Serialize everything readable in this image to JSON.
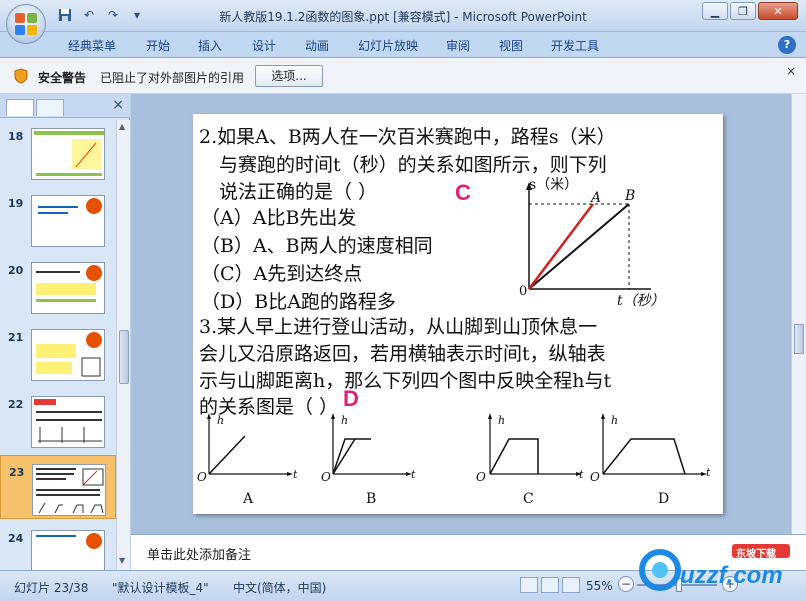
{
  "titlebar": {
    "title": "新人教版19.1.2函数的图象.ppt [兼容模式] - Microsoft PowerPoint",
    "minimize": "▁",
    "restore": "❐",
    "close": "✕"
  },
  "qat": {
    "save_icon": "save-icon",
    "undo_icon": "undo-icon",
    "redo_icon": "redo-icon",
    "customize": "▾"
  },
  "ribbon": {
    "tabs": [
      "经典菜单",
      "开始",
      "插入",
      "设计",
      "动画",
      "幻灯片放映",
      "审阅",
      "视图",
      "开发工具"
    ],
    "help": "?"
  },
  "security": {
    "title": "安全警告",
    "message": "已阻止了对外部图片的引用",
    "options_button": "选项...",
    "close": "×"
  },
  "slides_pane": {
    "close": "×",
    "slides": [
      {
        "number": "18"
      },
      {
        "number": "19"
      },
      {
        "number": "20"
      },
      {
        "number": "21"
      },
      {
        "number": "22"
      },
      {
        "number": "23"
      },
      {
        "number": "24"
      }
    ],
    "selected": "23"
  },
  "slide": {
    "q2_line1": "2.如果A、B两人在一次百米赛跑中，路程s（米）",
    "q2_line2": "与赛跑的时间t（秒）的关系如图所示，则下列",
    "q2_line3": "说法正确的是（    ）",
    "q2_answer": "C",
    "q2_optA": "（A）A比B先出发",
    "q2_optB": "（B）A、B两人的速度相同",
    "q2_optC": "（C）A先到达终点",
    "q2_optD": "（D）B比A跑的路程多",
    "q3_line1": "3.某人早上进行登山活动，从山脚到山顶休息一",
    "q3_line2": "会儿又沿原路返回，若用横轴表示时间t，纵轴表",
    "q3_line3": "示与山脚距离h，那么下列四个图中反映全程h与t",
    "q3_line4": "的关系图是（      ）",
    "q3_answer": "D",
    "graph1": {
      "y_label": "s（米）",
      "x_label": "t（秒）",
      "origin": "0",
      "line_a": "A",
      "line_b": "B"
    },
    "graphs": [
      {
        "label": "A",
        "h": "h",
        "t": "t",
        "origin": "O"
      },
      {
        "label": "B",
        "h": "h",
        "t": "t",
        "origin": "O"
      },
      {
        "label": "C",
        "h": "h",
        "t": "t",
        "origin": "O"
      },
      {
        "label": "D",
        "h": "h",
        "t": "t",
        "origin": "O"
      }
    ]
  },
  "notes": {
    "placeholder": "单击此处添加备注"
  },
  "status": {
    "slide_info": "幻灯片 23/38",
    "theme": "\"默认设计模板_4\"",
    "language": "中文(简体，中国)",
    "zoom": "55%",
    "zoom_fraction": 0.55
  },
  "watermark": {
    "text": "uzzf.com",
    "tag": "东坡下载"
  },
  "colors": {
    "answer": "#e0207c",
    "line_a": "#d02020",
    "line_b": "#111111",
    "selected_thumb": "#f6c26c"
  }
}
